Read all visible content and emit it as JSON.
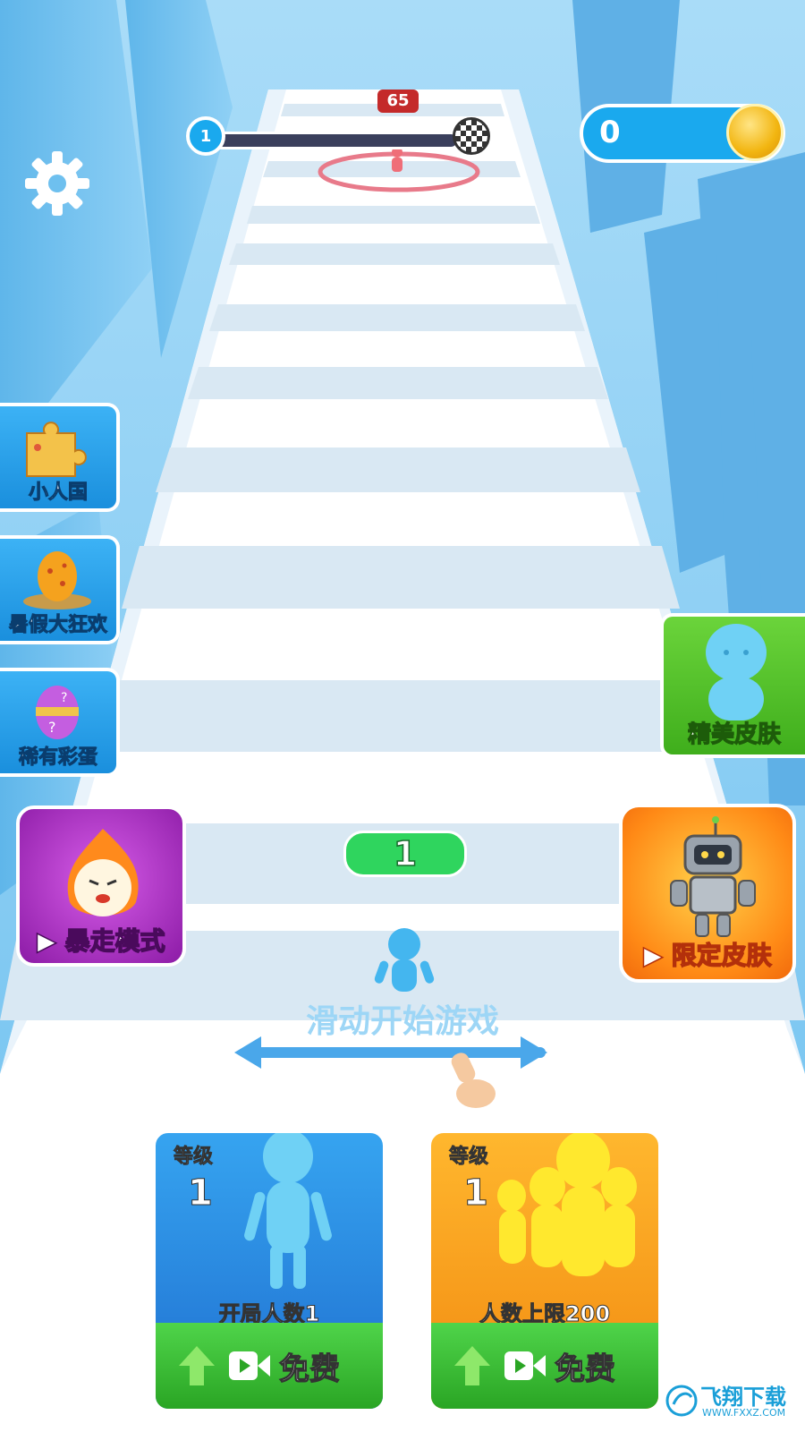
{
  "hud": {
    "level_current": "1",
    "enemy_count": "65",
    "coins": "0"
  },
  "side_menu": [
    {
      "label": "小人国",
      "icon": "puzzle-icon"
    },
    {
      "label": "暑假大狂欢",
      "icon": "egg-nest-icon"
    },
    {
      "label": "稀有彩蛋",
      "icon": "easter-egg-icon"
    }
  ],
  "special_mode": {
    "label": "暴走模式",
    "icon": "flame-character-icon"
  },
  "skins": {
    "fine_skin_label": "精美皮肤",
    "limited_skin_label": "限定皮肤"
  },
  "player": {
    "count": "1"
  },
  "hint": {
    "swipe_text": "滑动开始游戏"
  },
  "upgrades": [
    {
      "level_label": "等级",
      "level": "1",
      "stat_text": "开局人数1",
      "action_label": "免费"
    },
    {
      "level_label": "等级",
      "level": "1",
      "stat_text": "人数上限200",
      "action_label": "免费"
    }
  ],
  "watermark": {
    "title": "飞翔下载",
    "url": "WWW.FXXZ.COM"
  },
  "colors": {
    "sky": "#8fd0f5",
    "road": "#ffffff",
    "accent_blue": "#1aa9ee",
    "accent_green": "#3fae1c",
    "accent_orange": "#f28a10",
    "accent_purple": "#b23ecb"
  }
}
